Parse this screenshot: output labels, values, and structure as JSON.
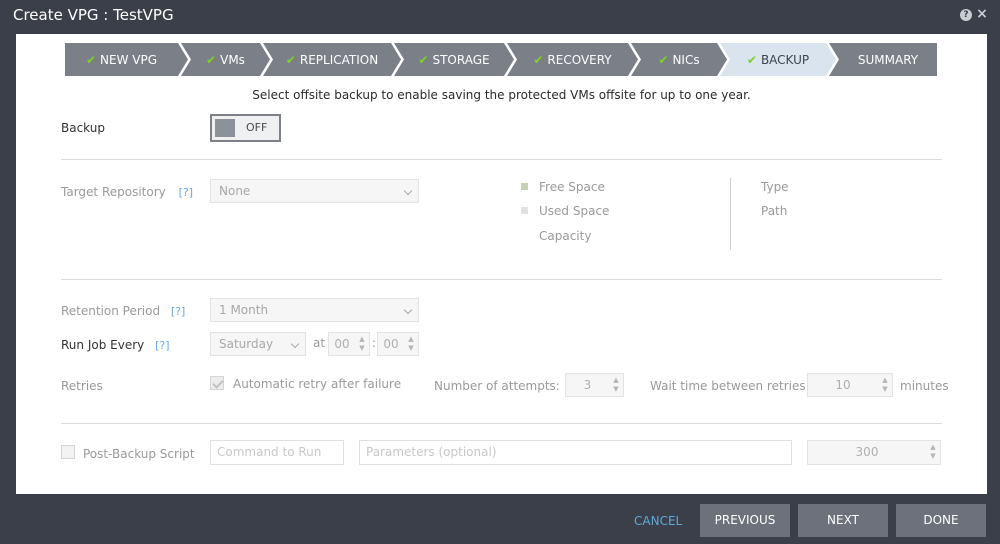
{
  "window": {
    "title": "Create VPG : TestVPG"
  },
  "wizard": {
    "steps": [
      {
        "label": "NEW VPG",
        "done": true
      },
      {
        "label": "VMs",
        "done": true
      },
      {
        "label": "REPLICATION",
        "done": true
      },
      {
        "label": "STORAGE",
        "done": true
      },
      {
        "label": "RECOVERY",
        "done": true
      },
      {
        "label": "NICs",
        "done": true
      },
      {
        "label": "BACKUP",
        "done": true,
        "active": true
      },
      {
        "label": "SUMMARY",
        "done": false
      }
    ],
    "check_glyph": "✔"
  },
  "instruction": "Select offsite backup to enable saving the protected VMs offsite for up to one year.",
  "backup": {
    "label": "Backup",
    "toggle_value": "OFF"
  },
  "target_repository": {
    "label": "Target Repository",
    "help": "[?]",
    "value": "None",
    "legend": {
      "free_space": "Free Space",
      "used_space": "Used Space",
      "capacity": "Capacity"
    },
    "info": {
      "type": "Type",
      "path": "Path"
    }
  },
  "retention": {
    "label": "Retention Period",
    "help": "[?]",
    "value": "1 Month"
  },
  "run_job": {
    "label": "Run Job Every",
    "help": "[?]",
    "day": "Saturday",
    "at_label": "at",
    "hour": "00",
    "separator": ":",
    "minute": "00"
  },
  "retries": {
    "label": "Retries",
    "auto_retry_label": "Automatic retry after failure",
    "auto_retry_checked": true,
    "attempts_label": "Number of attempts:",
    "attempts_value": "3",
    "wait_label": "Wait time between retries:",
    "wait_value": "10",
    "wait_unit": "minutes"
  },
  "post_backup": {
    "label": "Post-Backup Script",
    "checked": false,
    "command_placeholder": "Command to Run",
    "params_placeholder": "Parameters (optional)",
    "timeout_value": "300"
  },
  "footer": {
    "cancel": "CANCEL",
    "previous": "PREVIOUS",
    "next": "NEXT",
    "done": "DONE"
  },
  "colors": {
    "chrome": "#3b3f49",
    "step_done": "#7b7f87",
    "step_active": "#d9e4ee",
    "check": "#7ed321",
    "help_link": "#6aa8d8",
    "cancel_link": "#5fa9d9",
    "button": "#6c717b"
  }
}
